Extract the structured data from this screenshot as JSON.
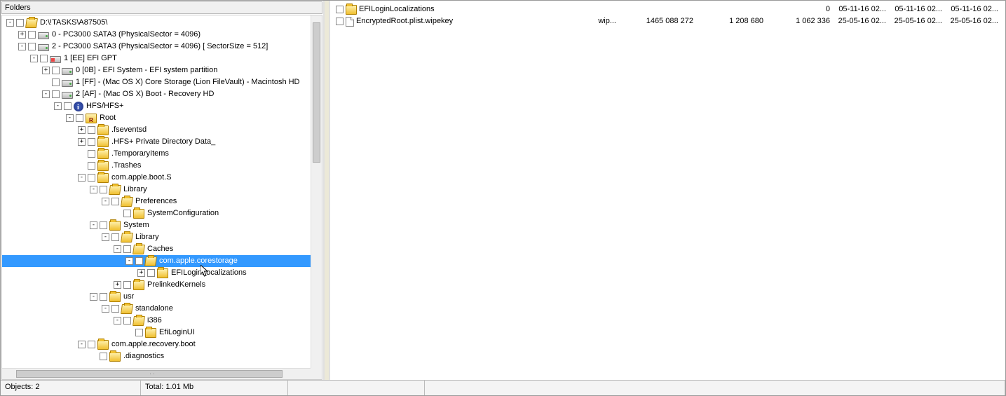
{
  "header": {
    "folders_label": "Folders"
  },
  "tree": [
    {
      "level": 0,
      "exp": "-",
      "chk": true,
      "icon": "folder-open",
      "label": "D:\\!TASKS\\A87505\\"
    },
    {
      "level": 1,
      "exp": "+",
      "chk": true,
      "icon": "drive",
      "label": "0 - PC3000 SATA3 (PhysicalSector = 4096)"
    },
    {
      "level": 1,
      "exp": "-",
      "chk": true,
      "icon": "drive",
      "label": "2 - PC3000 SATA3 (PhysicalSector = 4096) [ SectorSize =  512]"
    },
    {
      "level": 2,
      "exp": "-",
      "chk": true,
      "icon": "drive-red",
      "label": "1 [EE] EFI GPT"
    },
    {
      "level": 3,
      "exp": "+",
      "chk": true,
      "icon": "drive",
      "label": "0 [0B] - EFI System - EFI system partition"
    },
    {
      "level": 3,
      "exp": " ",
      "chk": true,
      "icon": "drive",
      "label": "1 [FF] - (Mac OS X) Core Storage (Lion FileVault) - Macintosh HD"
    },
    {
      "level": 3,
      "exp": "-",
      "chk": true,
      "icon": "drive",
      "label": "2 [AF] - (Mac OS X) Boot - Recovery HD"
    },
    {
      "level": 4,
      "exp": "-",
      "chk": true,
      "icon": "info",
      "label": "HFS/HFS+"
    },
    {
      "level": 5,
      "exp": "-",
      "chk": true,
      "icon": "folder-r",
      "label": "Root"
    },
    {
      "level": 6,
      "exp": "+",
      "chk": true,
      "icon": "folder",
      "label": ".fseventsd"
    },
    {
      "level": 6,
      "exp": "+",
      "chk": true,
      "icon": "folder",
      "label": ".HFS+ Private Directory Data_"
    },
    {
      "level": 6,
      "exp": " ",
      "chk": true,
      "icon": "folder",
      "label": ".TemporaryItems"
    },
    {
      "level": 6,
      "exp": " ",
      "chk": true,
      "icon": "folder",
      "label": ".Trashes"
    },
    {
      "level": 6,
      "exp": "-",
      "chk": true,
      "icon": "folder",
      "label": "com.apple.boot.S"
    },
    {
      "level": 7,
      "exp": "-",
      "chk": true,
      "icon": "folder-open",
      "label": "Library"
    },
    {
      "level": 8,
      "exp": "-",
      "chk": true,
      "icon": "folder-open",
      "label": "Preferences"
    },
    {
      "level": 9,
      "exp": " ",
      "chk": true,
      "icon": "folder",
      "label": "SystemConfiguration"
    },
    {
      "level": 7,
      "exp": "-",
      "chk": true,
      "icon": "folder",
      "label": "System"
    },
    {
      "level": 8,
      "exp": "-",
      "chk": true,
      "icon": "folder-open",
      "label": "Library"
    },
    {
      "level": 9,
      "exp": "-",
      "chk": true,
      "icon": "folder-open",
      "label": "Caches"
    },
    {
      "level": 10,
      "exp": "-",
      "chk": true,
      "icon": "folder-open",
      "label": "com.apple.corestorage",
      "selected": true
    },
    {
      "level": 11,
      "exp": "+",
      "chk": true,
      "icon": "folder",
      "label": "EFILoginLocalizations"
    },
    {
      "level": 9,
      "exp": "+",
      "chk": true,
      "icon": "folder",
      "label": "PrelinkedKernels"
    },
    {
      "level": 7,
      "exp": "-",
      "chk": true,
      "icon": "folder",
      "label": "usr"
    },
    {
      "level": 8,
      "exp": "-",
      "chk": true,
      "icon": "folder-open",
      "label": "standalone"
    },
    {
      "level": 9,
      "exp": "-",
      "chk": true,
      "icon": "folder-open",
      "label": "i386"
    },
    {
      "level": 10,
      "exp": " ",
      "chk": true,
      "icon": "folder",
      "label": "EfiLoginUI"
    },
    {
      "level": 6,
      "exp": "-",
      "chk": true,
      "icon": "folder",
      "label": "com.apple.recovery.boot"
    },
    {
      "level": 7,
      "exp": " ",
      "chk": true,
      "icon": "folder",
      "label": ".diagnostics"
    }
  ],
  "files": [
    {
      "icon": "folder",
      "name": "EFILoginLocalizations",
      "ext": "",
      "size": "",
      "s2": "",
      "s3": "0",
      "d1": "05-11-16 02...",
      "d2": "05-11-16 02...",
      "d3": "05-11-16 02..."
    },
    {
      "icon": "file",
      "name": "EncryptedRoot.plist.wipekey",
      "ext": "wip...",
      "size": "1465 088 272",
      "s2": "1 208 680",
      "s3": "1 062 336",
      "d1": "25-05-16 02...",
      "d2": "25-05-16 02...",
      "d3": "25-05-16 02..."
    }
  ],
  "status": {
    "objects": "Objects: 2",
    "total": "Total: 1.01 Mb"
  }
}
